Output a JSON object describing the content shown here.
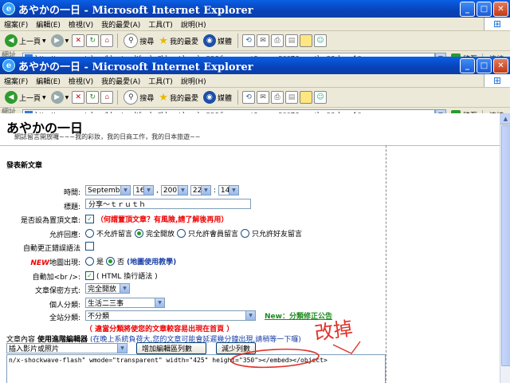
{
  "window_back": {
    "title": "あやかの一日 - Microsoft Internet Explorer",
    "menu": [
      "檔案(F)",
      "編輯(E)",
      "檢視(V)",
      "我的最愛(A)",
      "工具(T)",
      "說明(H)"
    ],
    "toolbar": {
      "back": "上一頁",
      "search": "搜尋",
      "favorites": "我的最愛",
      "media": "媒體"
    },
    "address_label": "網址(D)",
    "address": "http://www.wretch.cc/blog/modify.php?blog_id=color23&func=post&year=2007&month=9&day=16",
    "go": "移至",
    "links": "連結"
  },
  "window_front": {
    "title": "あやかの一日 - Microsoft Internet Explorer",
    "menu": [
      "檔案(F)",
      "編輯(E)",
      "檢視(V)",
      "我的最愛(A)",
      "工具(T)",
      "說明(H)"
    ],
    "toolbar": {
      "back": "上一頁",
      "search": "搜尋",
      "favorites": "我的最愛",
      "media": "媒體"
    },
    "address_label": "網址(D)",
    "address": "http://www.wretch.cc/blog/modify.php?blog_id=color23&func=post&year=2007&month=9&day=16",
    "go": "移至",
    "links": "連結"
  },
  "blog": {
    "title": "あやかの一日",
    "subtitle": "網誌留言開放囉~~~我的彩妝，我的日商工作，我的日本旅遊~~"
  },
  "form": {
    "section_title": "發表新文章",
    "time": {
      "label": "時間:",
      "month": "September",
      "day": "16",
      "year": "2007",
      "hour": "22",
      "minute": "14",
      "sep1": ",",
      "sep2": ":"
    },
    "subject": {
      "label": "標題:",
      "value": "分享～ｔｒｕｔｈ"
    },
    "sticky": {
      "label": "是否設為置頂文章:",
      "note": "（何謂置頂文章？有風險,請了解後再用）"
    },
    "comments": {
      "label": "允許回應:",
      "options": [
        "不允許留言",
        "完全開放",
        "只允許會員留言",
        "只允許好友留言"
      ]
    },
    "autocorrect": {
      "label": "自動更正錯誤語法"
    },
    "map": {
      "new": "NEW",
      "label": "地圖出現:",
      "yes": "是",
      "no": "否",
      "help": "(地圖使用教學)"
    },
    "autobr": {
      "label": "自動加<br />:",
      "option": "( HTML 換行語法 )"
    },
    "privacy": {
      "label": "文章保密方式:",
      "value": "完全開放"
    },
    "personal_cat": {
      "label": "個人分類:",
      "value": "生活二三事"
    },
    "site_cat": {
      "label": "全站分類:",
      "value": "不分類",
      "notice": "New：分類修正公告",
      "note": "（ 違當分類將使您的文章較容易出現在首頁 ）"
    },
    "content": {
      "label": "文章內容",
      "editor_label": "使用進階編輯器",
      "editor_note": "(在晚上系統負荷大,您的文章可能會延遲幾分鐘出現,請稍等一下囉)",
      "insert_select": "插入影片或照片",
      "btn_enlarge": "增加編輯區列數",
      "btn_reduce": "減少列數",
      "code": "n/x-shockwave-flash\" wmode=\"transparent\" width=\"425\" height=\"350\"></embed></object>"
    }
  },
  "annotation": {
    "text": "改掉",
    "color": "#e0322a"
  }
}
